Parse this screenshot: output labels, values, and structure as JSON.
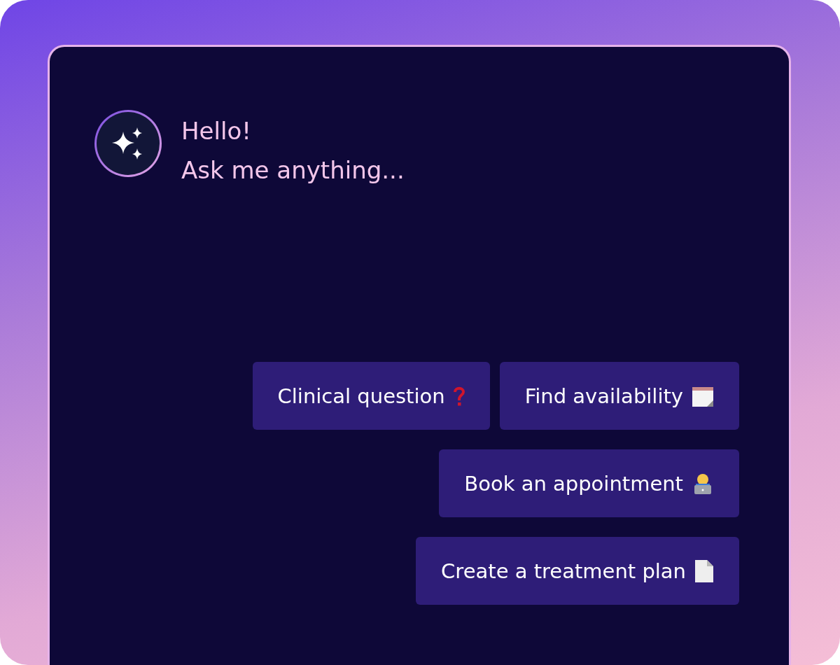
{
  "greeting": {
    "title": "Hello!",
    "subtitle": "Ask me anything..."
  },
  "suggestion_rows": [
    {
      "buttons": [
        {
          "label": "Clinical question",
          "kind": "question"
        },
        {
          "label": "Find availability",
          "kind": "notepad"
        }
      ]
    },
    {
      "buttons": [
        {
          "label": "Book an appointment",
          "kind": "person-laptop"
        }
      ]
    },
    {
      "buttons": [
        {
          "label": "Create a treatment plan",
          "kind": "document"
        }
      ]
    }
  ]
}
